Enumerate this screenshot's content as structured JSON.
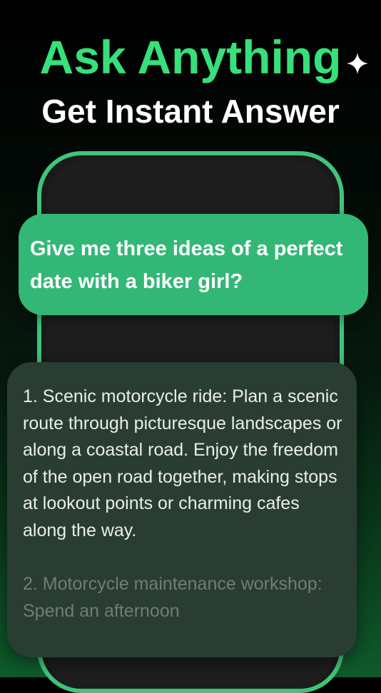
{
  "headline": {
    "title": "Ask Anything",
    "subtitle": "Get Instant Answer",
    "sparkle_icon": "sparkle-icon",
    "accent_color": "#37e07a"
  },
  "chat": {
    "user_message": "Give me three ideas of a perfect date with a biker girl?",
    "assistant_message": {
      "point_1": "1. Scenic motorcycle ride: Plan a scenic route through picturesque landscapes or along a coastal road. Enjoy the freedom of the open road together, making stops at lookout points or charming cafes along the way.",
      "point_2": "2. Motorcycle maintenance workshop: Spend an afternoon"
    },
    "user_bubble_color": "#33b777",
    "assistant_bubble_color": "#2a3d33"
  }
}
